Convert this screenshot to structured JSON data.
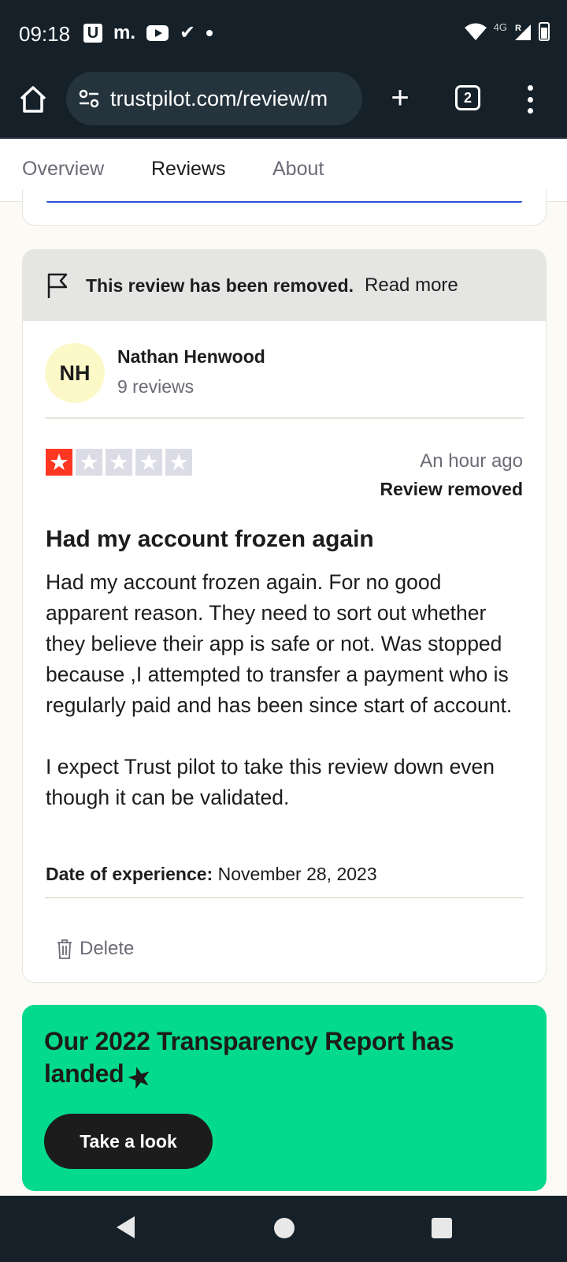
{
  "status_bar": {
    "time": "09:18",
    "notif_u": "U",
    "notif_m": "m.",
    "network": "4G",
    "network_sub": "R"
  },
  "browser": {
    "url": "trustpilot.com/review/m",
    "tab_count": "2"
  },
  "tabs": [
    {
      "label": "Overview",
      "active": false
    },
    {
      "label": "Reviews",
      "active": true
    },
    {
      "label": "About",
      "active": false
    }
  ],
  "review": {
    "removed_banner": "This review has been removed.",
    "read_more": "Read more",
    "avatar_initials": "NH",
    "author_name": "Nathan Henwood",
    "author_reviews": "9 reviews",
    "rating": 1,
    "rating_max": 5,
    "time_ago": "An hour ago",
    "status": "Review removed",
    "title": "Had my account frozen again",
    "body_p1": "Had my account frozen again. For no good apparent reason. They need to sort out whether they believe their app is safe or not. Was stopped because ,I attempted to transfer a payment who is regularly paid and has been since start of account.",
    "body_p2": "I expect Trust pilot to take this review down even though it can be validated.",
    "date_label": "Date of experience:",
    "date_value": "November 28, 2023",
    "delete_label": "Delete"
  },
  "promo": {
    "title": "Our 2022 Transparency Report has landed",
    "button": "Take a look"
  },
  "colors": {
    "star_filled": "#ff3722",
    "promo_bg": "#04da8d",
    "system_bar": "#152028"
  }
}
